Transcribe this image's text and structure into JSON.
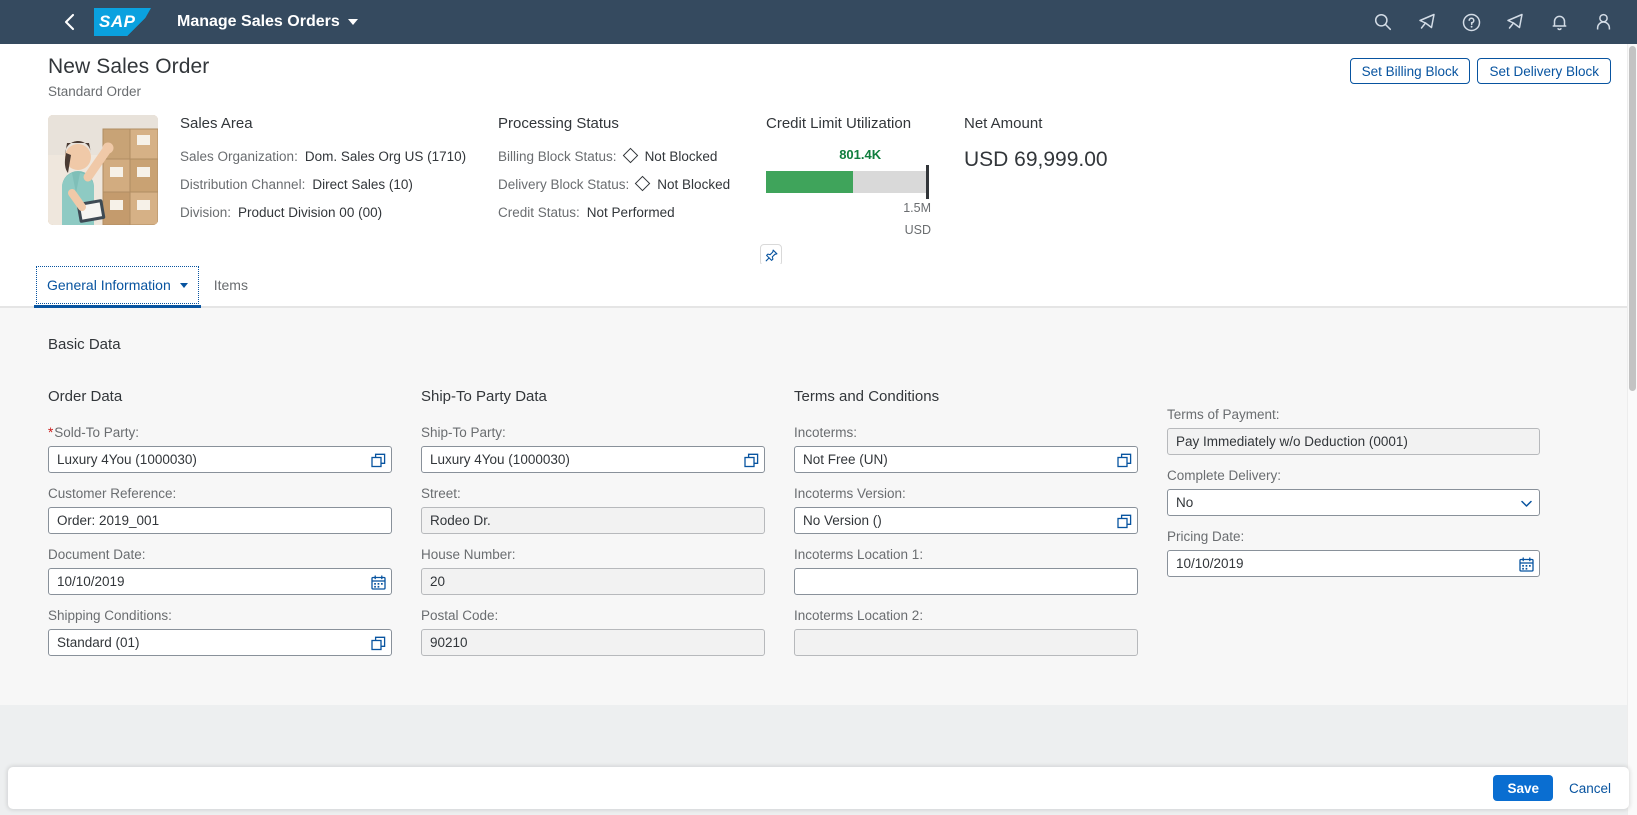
{
  "shell": {
    "back_icon": "back-chevron-icon",
    "logo_text": "SAP",
    "app_title": "Manage Sales Orders",
    "icons": [
      {
        "name": "search-icon",
        "label": "Search"
      },
      {
        "name": "megaphone-icon",
        "label": "Feedback"
      },
      {
        "name": "help-icon",
        "label": "Help"
      },
      {
        "name": "megaphone-alt-icon",
        "label": "Announcements"
      },
      {
        "name": "bell-icon",
        "label": "Notifications"
      },
      {
        "name": "user-avatar-icon",
        "label": "User"
      }
    ]
  },
  "object_page": {
    "title": "New Sales Order",
    "subtitle": "Standard Order",
    "actions": [
      {
        "name": "set-billing-block-button",
        "label": "Set Billing Block"
      },
      {
        "name": "set-delivery-block-button",
        "label": "Set Delivery Block"
      }
    ],
    "image_alt": "warehouse-worker-photo",
    "sales_area": {
      "title": "Sales Area",
      "fields": [
        {
          "label": "Sales Organization:",
          "value": "Dom. Sales Org US (1710)"
        },
        {
          "label": "Distribution Channel:",
          "value": "Direct Sales (10)"
        },
        {
          "label": "Division:",
          "value": "Product Division 00 (00)"
        }
      ]
    },
    "processing_status": {
      "title": "Processing Status",
      "fields": [
        {
          "label": "Billing Block Status:",
          "value": "Not Blocked",
          "icon": "diamond-status-icon"
        },
        {
          "label": "Delivery Block Status:",
          "value": "Not Blocked",
          "icon": "diamond-status-icon"
        },
        {
          "label": "Credit Status:",
          "value": "Not Performed",
          "icon": null
        }
      ]
    },
    "credit_limit": {
      "title": "Credit Limit Utilization",
      "value_label": "801.4K",
      "max_label": "1.5M",
      "currency": "USD",
      "fill_color": "#3fa45b",
      "track_color": "#d9d9d9",
      "value_color": "#107e3e"
    },
    "net_amount": {
      "title": "Net Amount",
      "value": "USD 69,999.00"
    },
    "pin_icon": "pin-icon"
  },
  "tabs": [
    {
      "name": "tab-general-information",
      "label": "General Information",
      "selected": true,
      "has_caret": true
    },
    {
      "name": "tab-items",
      "label": "Items",
      "selected": false,
      "has_caret": false
    }
  ],
  "form": {
    "section_title": "Basic Data",
    "columns": [
      {
        "title": "Order Data",
        "fields": [
          {
            "name": "sold-to-party-field",
            "label": "Sold-To Party:",
            "value": "Luxury 4You (1000030)",
            "required": true,
            "readonly": false,
            "icon": "value-help-icon"
          },
          {
            "name": "customer-reference-field",
            "label": "Customer Reference:",
            "value": "Order: 2019_001",
            "required": false,
            "readonly": false,
            "icon": null
          },
          {
            "name": "document-date-field",
            "label": "Document Date:",
            "value": "10/10/2019",
            "required": false,
            "readonly": false,
            "icon": "calendar-icon"
          },
          {
            "name": "shipping-conditions-field",
            "label": "Shipping Conditions:",
            "value": "Standard (01)",
            "required": false,
            "readonly": false,
            "icon": "value-help-icon"
          }
        ]
      },
      {
        "title": "Ship-To Party Data",
        "fields": [
          {
            "name": "ship-to-party-field",
            "label": "Ship-To Party:",
            "value": "Luxury 4You (1000030)",
            "required": false,
            "readonly": false,
            "icon": "value-help-icon"
          },
          {
            "name": "street-field",
            "label": "Street:",
            "value": "Rodeo Dr.",
            "required": false,
            "readonly": true,
            "icon": null
          },
          {
            "name": "house-number-field",
            "label": "House Number:",
            "value": "20",
            "required": false,
            "readonly": true,
            "icon": null
          },
          {
            "name": "postal-code-field",
            "label": "Postal Code:",
            "value": "90210",
            "required": false,
            "readonly": true,
            "icon": null
          }
        ]
      },
      {
        "title": "Terms and Conditions",
        "fields": [
          {
            "name": "incoterms-field",
            "label": "Incoterms:",
            "value": "Not Free (UN)",
            "required": false,
            "readonly": false,
            "icon": "value-help-icon"
          },
          {
            "name": "incoterms-version-field",
            "label": "Incoterms Version:",
            "value": "No Version ()",
            "required": false,
            "readonly": false,
            "icon": "value-help-icon"
          },
          {
            "name": "incoterms-location-1-field",
            "label": "Incoterms Location 1:",
            "value": "",
            "required": false,
            "readonly": false,
            "icon": null
          },
          {
            "name": "incoterms-location-2-field",
            "label": "Incoterms Location 2:",
            "value": "",
            "required": false,
            "readonly": true,
            "icon": null
          }
        ]
      },
      {
        "title": "",
        "fields": [
          {
            "name": "terms-of-payment-field",
            "label": "Terms of Payment:",
            "value": "Pay Immediately w/o Deduction (0001)",
            "required": false,
            "readonly": true,
            "icon": null
          },
          {
            "name": "complete-delivery-field",
            "label": "Complete Delivery:",
            "value": "No",
            "required": false,
            "readonly": false,
            "icon": "chevron-down-icon"
          },
          {
            "name": "pricing-date-field",
            "label": "Pricing Date:",
            "value": "10/10/2019",
            "required": false,
            "readonly": false,
            "icon": "calendar-icon"
          }
        ]
      }
    ]
  },
  "footer": {
    "save_label": "Save",
    "cancel_label": "Cancel"
  }
}
